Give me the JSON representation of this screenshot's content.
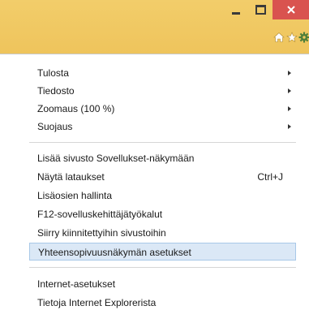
{
  "window": {
    "accent": "#f0c860",
    "close_color": "#d9534f"
  },
  "toolbar_icons": [
    "home-icon",
    "star-icon",
    "gear-icon"
  ],
  "menu": {
    "group1": [
      {
        "label": "Tulosta",
        "submenu": true
      },
      {
        "label": "Tiedosto",
        "submenu": true
      },
      {
        "label": "Zoomaus (100 %)",
        "submenu": true
      },
      {
        "label": "Suojaus",
        "submenu": true
      }
    ],
    "group2": [
      {
        "label": "Lisää sivusto Sovellukset-näkymään"
      },
      {
        "label": "Näytä lataukset",
        "shortcut": "Ctrl+J"
      },
      {
        "label": "Lisäosien hallinta"
      },
      {
        "label": "F12-sovelluskehittäjätyökalut"
      },
      {
        "label": "Siirry kiinnitettyihin sivustoihin"
      },
      {
        "label": "Yhteensopivuusnäkymän asetukset",
        "highlighted": true
      }
    ],
    "group3": [
      {
        "label": "Internet-asetukset"
      },
      {
        "label": "Tietoja Internet Explorerista"
      }
    ]
  }
}
